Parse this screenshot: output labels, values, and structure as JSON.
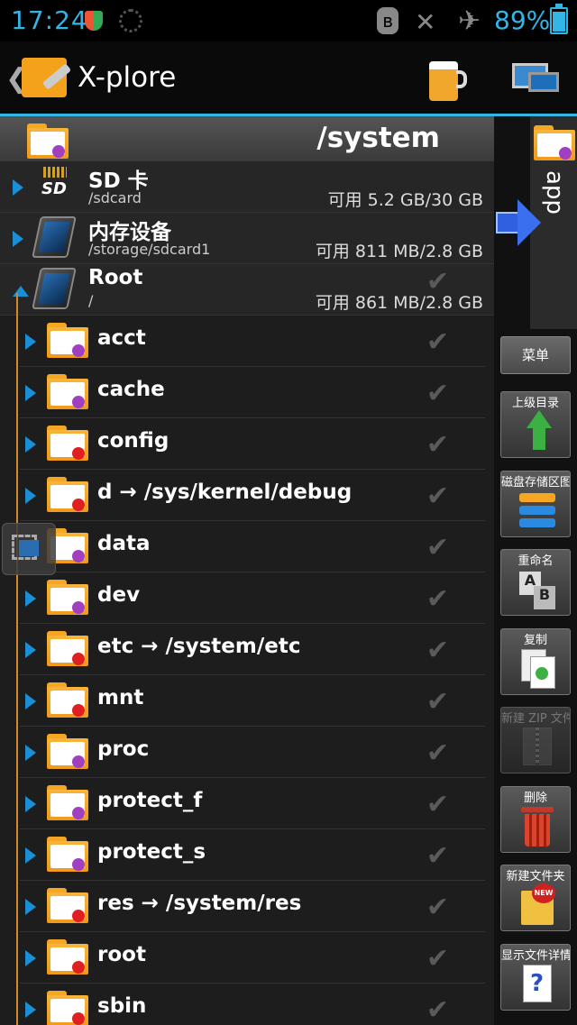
{
  "status_bar": {
    "time": "17:24",
    "battery": "89%",
    "icons": [
      "shield-icon",
      "loading-spinner-icon",
      "bluetooth-icon",
      "mute-icon",
      "airplane-icon",
      "battery-icon"
    ]
  },
  "titlebar": {
    "title": "X-plore",
    "back_glyph": "❮",
    "app_icon": "x-plore-app-icon",
    "actions": [
      "beer-donate-icon",
      "wifi-file-sharing-icon"
    ]
  },
  "path_header": {
    "path": "/system"
  },
  "volumes": [
    {
      "name": "SD 卡",
      "path": "/sdcard",
      "space": "可用 5.2 GB/30 GB",
      "icon": "sd-card-icon",
      "expanded": false
    },
    {
      "name": "内存设备",
      "path": "/storage/sdcard1",
      "space": "可用 811 MB/2.8 GB",
      "icon": "phone-storage-icon",
      "expanded": false
    },
    {
      "name": "Root",
      "path": "/",
      "space": "可用 861 MB/2.8 GB",
      "icon": "phone-storage-icon",
      "expanded": true
    }
  ],
  "files": [
    {
      "name": "acct",
      "dot": "#a040c0"
    },
    {
      "name": "cache",
      "dot": "#a040c0"
    },
    {
      "name": "config",
      "dot": "#e02020"
    },
    {
      "name": "d → /sys/kernel/debug",
      "dot": "#e02020"
    },
    {
      "name": "data",
      "dot": "#a040c0"
    },
    {
      "name": "dev",
      "dot": "#a040c0"
    },
    {
      "name": "etc → /system/etc",
      "dot": "#e02020"
    },
    {
      "name": "mnt",
      "dot": "#e02020"
    },
    {
      "name": "proc",
      "dot": "#a040c0"
    },
    {
      "name": "protect_f",
      "dot": "#a040c0"
    },
    {
      "name": "protect_s",
      "dot": "#a040c0"
    },
    {
      "name": "res → /system/res",
      "dot": "#e02020"
    },
    {
      "name": "root",
      "dot": "#e02020"
    },
    {
      "name": "sbin",
      "dot": "#e02020"
    }
  ],
  "check_glyph": "✔",
  "right_pane": {
    "folder_label": "app",
    "menu_label": "菜单",
    "tools": [
      {
        "label": "上级目录",
        "icon": "up-arrow-icon",
        "enabled": true
      },
      {
        "label": "磁盘存储区图",
        "icon": "disk-map-icon",
        "enabled": true
      },
      {
        "label": "重命名",
        "icon": "rename-icon",
        "enabled": true
      },
      {
        "label": "复制",
        "icon": "copy-icon",
        "enabled": true
      },
      {
        "label": "新建 ZIP 文件",
        "icon": "zip-icon",
        "enabled": false
      },
      {
        "label": "删除",
        "icon": "trash-icon",
        "enabled": true
      },
      {
        "label": "新建文件夹",
        "icon": "new-folder-icon",
        "enabled": true
      },
      {
        "label": "显示文件详情",
        "icon": "help-icon",
        "enabled": true
      }
    ]
  },
  "colors": {
    "accent": "#33b5e5",
    "arrow": "#1a8fd6",
    "folder": "#f5a623",
    "tree_line": "#d08a2a"
  }
}
